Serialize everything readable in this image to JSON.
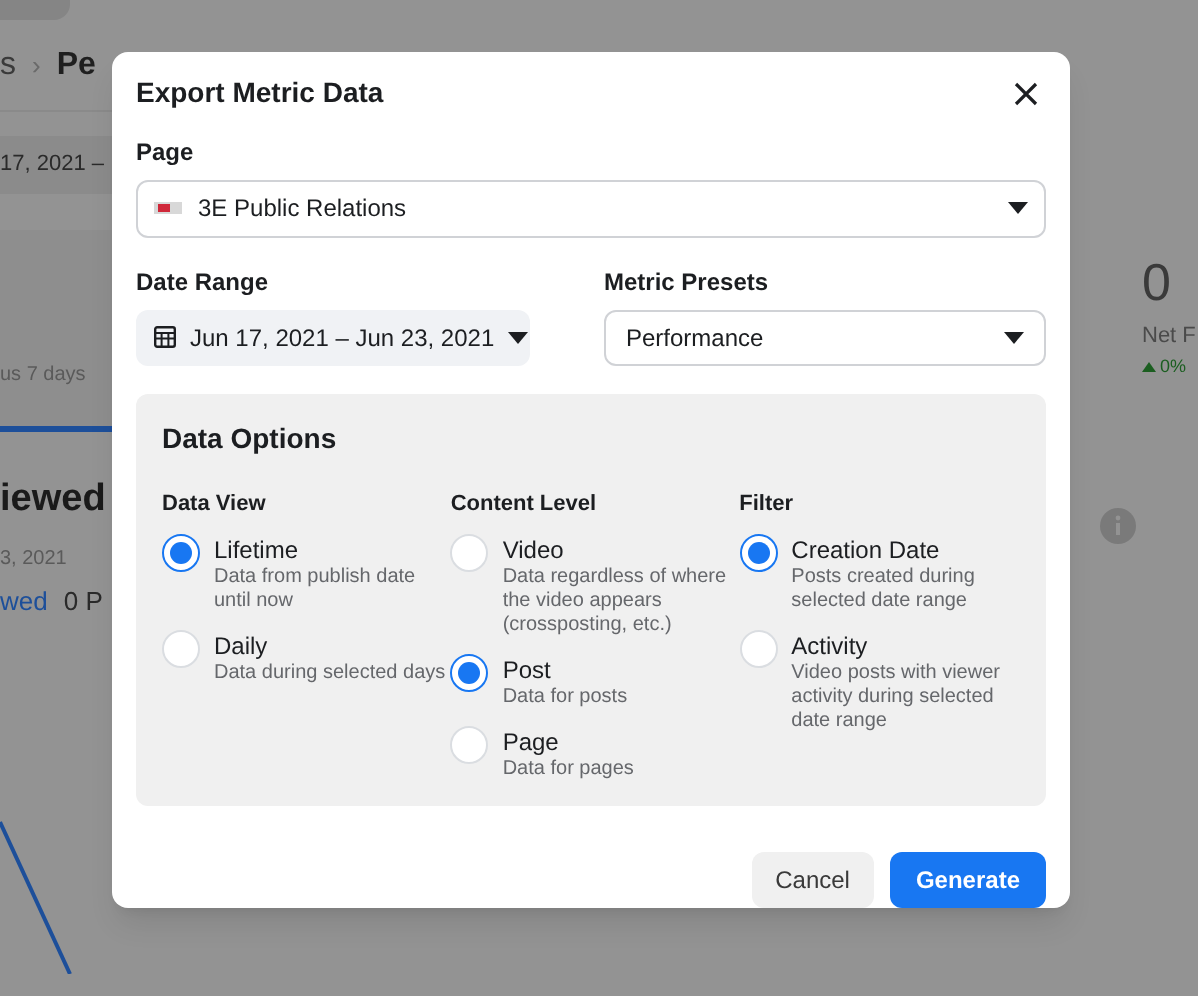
{
  "background": {
    "breadcrumb": {
      "parent": "s",
      "separator": "›",
      "current": "Pe"
    },
    "date_pill": "17, 2021 –",
    "card_caption": "us 7 days",
    "section_title": "iewed",
    "section_date": "3, 2021",
    "section_tab_1": "wed",
    "section_tab_2": "0 P",
    "stat": {
      "value": "0",
      "label": "Net F",
      "change": "0%"
    }
  },
  "dialog": {
    "title": "Export Metric Data",
    "page_field": {
      "label": "Page",
      "value": "3E Public Relations"
    },
    "date_range": {
      "label": "Date Range",
      "value": "Jun 17, 2021 – Jun 23, 2021"
    },
    "metric_presets": {
      "label": "Metric Presets",
      "value": "Performance"
    },
    "data_options": {
      "title": "Data Options",
      "groups": [
        {
          "title": "Data View",
          "options": [
            {
              "label": "Lifetime",
              "description": "Data from publish date until now",
              "selected": true
            },
            {
              "label": "Daily",
              "description": "Data during selected days",
              "selected": false
            }
          ]
        },
        {
          "title": "Content Level",
          "options": [
            {
              "label": "Video",
              "description": "Data regardless of where the video appears (crossposting, etc.)",
              "selected": false
            },
            {
              "label": "Post",
              "description": "Data for posts",
              "selected": true
            },
            {
              "label": "Page",
              "description": "Data for pages",
              "selected": false
            }
          ]
        },
        {
          "title": "Filter",
          "options": [
            {
              "label": "Creation Date",
              "description": "Posts created during selected date range",
              "selected": true
            },
            {
              "label": "Activity",
              "description": "Video posts with viewer activity during selected date range",
              "selected": false
            }
          ]
        }
      ]
    },
    "buttons": [
      {
        "label": "Cancel",
        "kind": "secondary"
      },
      {
        "label": "Generate",
        "kind": "primary"
      }
    ]
  }
}
